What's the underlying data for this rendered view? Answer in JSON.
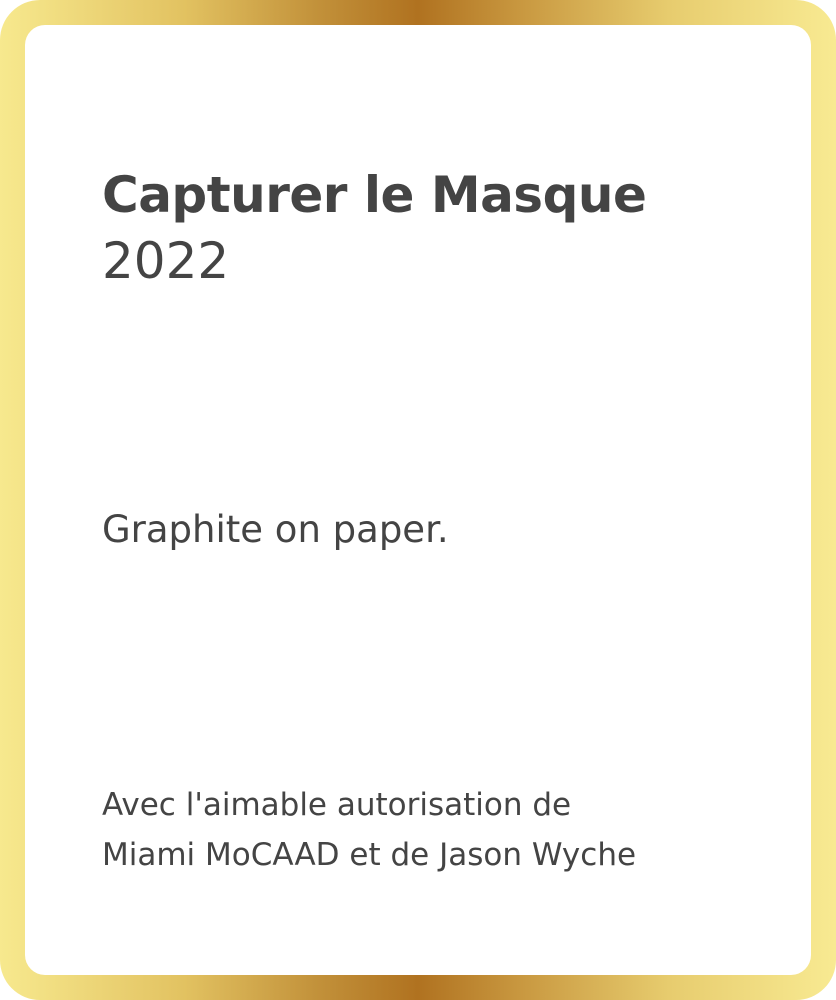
{
  "card": {
    "title": "Capturer le Masque",
    "year": "2022",
    "medium": "Graphite on paper.",
    "credit": {
      "line1": "Avec l'aimable autorisation de",
      "line2": "Miami MoCAAD et de Jason Wyche"
    }
  },
  "colors": {
    "text": "#444444",
    "frame_light": "#f7e98e",
    "frame_dark": "#b07220",
    "card_background": "#ffffff"
  }
}
